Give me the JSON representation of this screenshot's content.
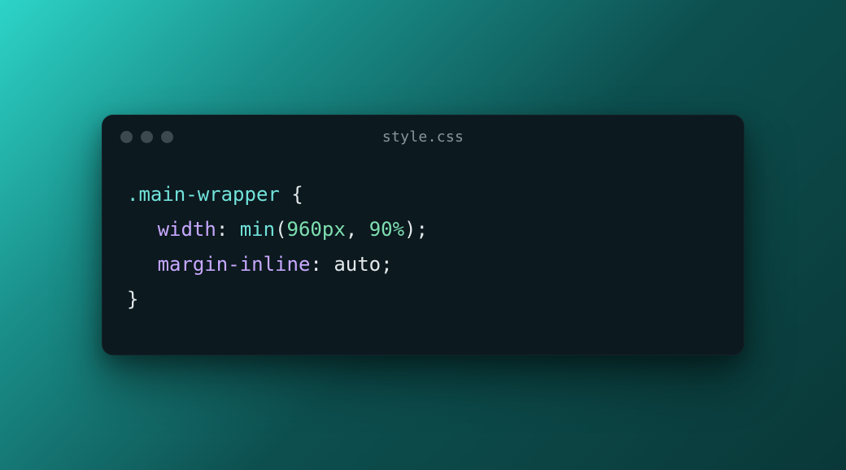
{
  "window": {
    "title": "style.css"
  },
  "code": {
    "line1": {
      "selector": ".main-wrapper",
      "space": " ",
      "brace_open": "{"
    },
    "line2": {
      "prop": "width",
      "colon": ": ",
      "func": "min",
      "paren_open": "(",
      "arg1": "960px",
      "comma": ", ",
      "arg2": "90%",
      "paren_close": ")",
      "semi": ";"
    },
    "line3": {
      "prop": "margin-inline",
      "colon": ": ",
      "value": "auto",
      "semi": ";"
    },
    "line4": {
      "brace_close": "}"
    }
  }
}
